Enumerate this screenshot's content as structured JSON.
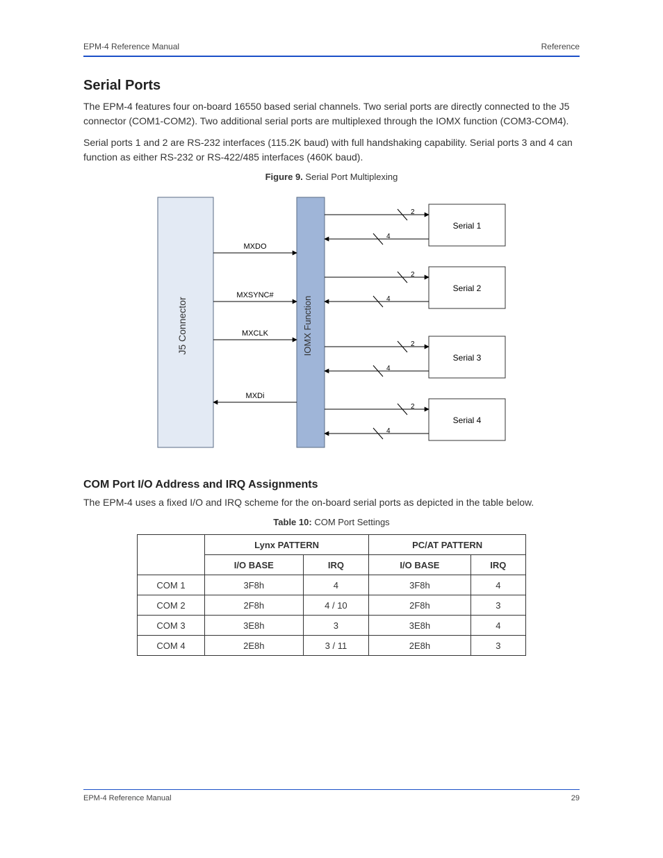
{
  "header": {
    "left": "EPM-4 Reference Manual",
    "right": "Reference"
  },
  "section": {
    "title": "Serial Ports",
    "p1": "The EPM-4 features four on-board 16550 based serial channels. Two serial ports are directly connected to the J5 connector (COM1-COM2). Two additional serial ports are multiplexed through the IOMX function (COM3-COM4).",
    "p2": "Serial ports 1 and 2 are RS-232 interfaces (115.2K baud) with full handshaking capability. Serial ports 3 and 4 can function as either RS-232 or RS-422/485 interfaces (460K baud)."
  },
  "figure": {
    "caption_label": "Figure 9.",
    "caption_text": "Serial Port Multiplexing",
    "left_block": "J5 Connector",
    "mid_block": "IOMX Function",
    "signals": [
      "MXDO",
      "MXSYNC#",
      "MXCLK",
      "MXDi"
    ],
    "right_blocks": [
      "Serial 1",
      "Serial 2",
      "Serial 3",
      "Serial 4"
    ],
    "top_count": "2",
    "bot_count": "4"
  },
  "subsection": {
    "title": "COM Port I/O Address and IRQ Assignments",
    "p1": "The EPM-4 uses a fixed I/O and IRQ scheme for the on-board serial ports as depicted in the table below."
  },
  "table": {
    "caption_label": "Table 10:",
    "caption_text": "COM Port Settings",
    "group_headers": [
      "Lynx PATTERN",
      "PC/AT PATTERN"
    ],
    "col_headers": [
      "I/O BASE",
      "IRQ",
      "I/O BASE",
      "IRQ"
    ],
    "rows": [
      {
        "label": "COM 1",
        "cells": [
          "3F8h",
          "4",
          "3F8h",
          "4"
        ]
      },
      {
        "label": "COM 2",
        "cells": [
          "2F8h",
          "4 / 10",
          "2F8h",
          "3"
        ]
      },
      {
        "label": "COM 3",
        "cells": [
          "3E8h",
          "3",
          "3E8h",
          "4"
        ]
      },
      {
        "label": "COM 4",
        "cells": [
          "2E8h",
          "3 / 11",
          "2E8h",
          "3"
        ]
      }
    ]
  },
  "footer": {
    "left": "EPM-4 Reference Manual",
    "right": "29"
  }
}
